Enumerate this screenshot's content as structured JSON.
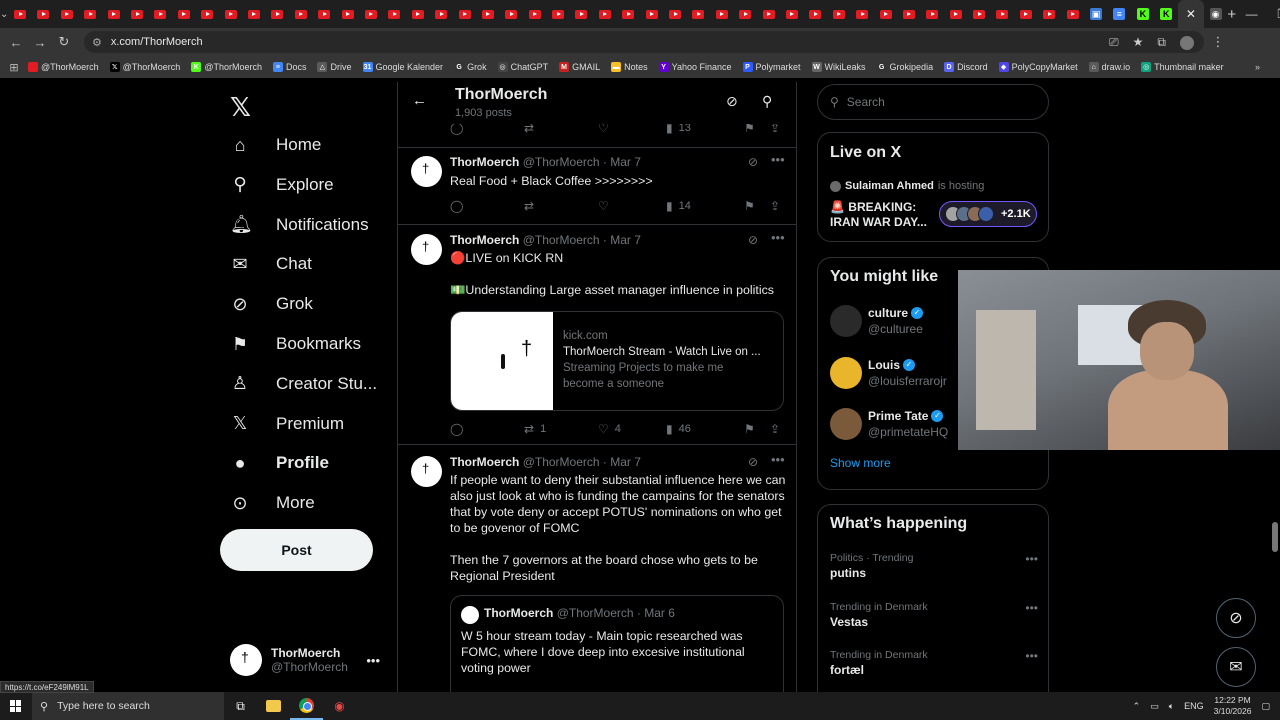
{
  "browser": {
    "url": "x.com/ThorMoerch",
    "tab_count": 46,
    "bookmarks": [
      {
        "label": "@ThorMoerch",
        "icon": "youtube-icon",
        "color": "#e31b23",
        "glyph": ""
      },
      {
        "label": "@ThorMoerch",
        "icon": "x-icon",
        "color": "#000000",
        "glyph": "𝕏"
      },
      {
        "label": "@ThorMoerch",
        "icon": "kick-icon",
        "color": "#53fc18",
        "glyph": "K"
      },
      {
        "label": "Docs",
        "icon": "docs-icon",
        "color": "#4285f4",
        "glyph": "≡"
      },
      {
        "label": "Drive",
        "icon": "drive-icon",
        "color": "#5a5a5a",
        "glyph": "△"
      },
      {
        "label": "Google Kalender",
        "icon": "calendar-icon",
        "color": "#4285f4",
        "glyph": "31"
      },
      {
        "label": "Grok",
        "icon": "grok-icon",
        "color": "#333333",
        "glyph": "G"
      },
      {
        "label": "ChatGPT",
        "icon": "chatgpt-icon",
        "color": "#444444",
        "glyph": "◎"
      },
      {
        "label": "GMAIL",
        "icon": "gmail-icon",
        "color": "#c5221f",
        "glyph": "M"
      },
      {
        "label": "Notes",
        "icon": "notes-icon",
        "color": "#f6c026",
        "glyph": "▬"
      },
      {
        "label": "Yahoo Finance",
        "icon": "yahoo-icon",
        "color": "#6001d2",
        "glyph": "Y"
      },
      {
        "label": "Polymarket",
        "icon": "polymarket-icon",
        "color": "#2d5bff",
        "glyph": "P"
      },
      {
        "label": "WikiLeaks",
        "icon": "wikileaks-icon",
        "color": "#666666",
        "glyph": "W"
      },
      {
        "label": "Grokipedia",
        "icon": "grokipedia-icon",
        "color": "#333333",
        "glyph": "G"
      },
      {
        "label": "Discord",
        "icon": "discord-icon",
        "color": "#5865f2",
        "glyph": "D"
      },
      {
        "label": "PolyCopyMarket",
        "icon": "polycopy-icon",
        "color": "#4f46e5",
        "glyph": "◆"
      },
      {
        "label": "draw.io",
        "icon": "drawio-icon",
        "color": "#5a5a5a",
        "glyph": "⌂"
      },
      {
        "label": "Thumbnail maker",
        "icon": "thumbnail-icon",
        "color": "#0fa37f",
        "glyph": "◎"
      }
    ],
    "status_url": "https://t.co/eF249lM91L"
  },
  "nav": {
    "items": [
      {
        "label": "Home",
        "icon": "home-icon",
        "glyph": "⌂"
      },
      {
        "label": "Explore",
        "icon": "search-icon",
        "glyph": "⚲"
      },
      {
        "label": "Notifications",
        "icon": "bell-icon",
        "glyph": "🔔︎"
      },
      {
        "label": "Chat",
        "icon": "mail-icon",
        "glyph": "✉"
      },
      {
        "label": "Grok",
        "icon": "grok-icon",
        "glyph": "⊘"
      },
      {
        "label": "Bookmarks",
        "icon": "bookmark-icon",
        "glyph": "⚑"
      },
      {
        "label": "Creator Stu...",
        "icon": "creator-studio-icon",
        "glyph": "♙"
      },
      {
        "label": "Premium",
        "icon": "x-premium-icon",
        "glyph": "𝕏"
      },
      {
        "label": "Profile",
        "icon": "person-icon",
        "glyph": "●"
      },
      {
        "label": "More",
        "icon": "more-circle-icon",
        "glyph": "⊙"
      }
    ],
    "post_label": "Post",
    "account_name": "ThorMoerch",
    "account_handle": "@ThorMoerch"
  },
  "profile_header": {
    "name": "ThorMoerch",
    "posts": "1,903 posts"
  },
  "tweets": {
    "prev_actions": {
      "views": "13"
    },
    "t1": {
      "name": "ThorMoerch",
      "meta": "@ThorMoerch · Mar 7",
      "text": "Real Food + Black Coffee >>>>>>>>",
      "views": "14"
    },
    "t2": {
      "name": "ThorMoerch",
      "meta": "@ThorMoerch · Mar 7",
      "text": "🔴LIVE on KICK RN\n\n💵Understanding Large asset manager influence in politics",
      "card_domain": "kick.com",
      "card_title": "ThorMoerch Stream - Watch Live on ...",
      "card_desc": "Streaming Projects to make me become a someone",
      "reposts": "1",
      "likes": "4",
      "views": "46"
    },
    "t3": {
      "name": "ThorMoerch",
      "meta": "@ThorMoerch · Mar 7",
      "text": "If people want to deny their substantial influence here we can also just look at who is funding the campains for the senators that by vote deny or accept POTUS' nominations on who get to be govenor of FOMC\n\nThen the 7 governors at the board chose who gets to be Regional President",
      "quote_name": "ThorMoerch",
      "quote_meta": "@ThorMoerch · Mar 6",
      "quote_text": "W 5 hour stream today - Main topic researched was FOMC, where I dove deep into excesive institutional voting power"
    }
  },
  "sidebar": {
    "search_placeholder": "Search",
    "live": {
      "title": "Live on X",
      "host_name": "Sulaiman Ahmed",
      "host_suffix": "is hosting",
      "stream_title": "🚨 BREAKING: IRAN WAR DAY...",
      "listeners": "+2.1K"
    },
    "suggest": {
      "title": "You might like",
      "accounts": [
        {
          "name": "culture",
          "handle": "@culturee",
          "color": "#2a2a2a"
        },
        {
          "name": "Louis",
          "handle": "@louisferrarojr",
          "color": "#e9b52b"
        },
        {
          "name": "Prime Tate",
          "handle": "@primetateHQ",
          "color": "#7a5a3a"
        }
      ],
      "show_more": "Show more"
    },
    "happening": {
      "title": "What’s happening",
      "trends": [
        {
          "meta": "Politics · Trending",
          "name": "putins"
        },
        {
          "meta": "Trending in Denmark",
          "name": "Vestas"
        },
        {
          "meta": "Trending in Denmark",
          "name": "fortæl"
        }
      ]
    }
  },
  "taskbar": {
    "search_placeholder": "Type here to search",
    "lang": "ENG",
    "time": "12:22 PM",
    "date": "3/10/2026"
  }
}
